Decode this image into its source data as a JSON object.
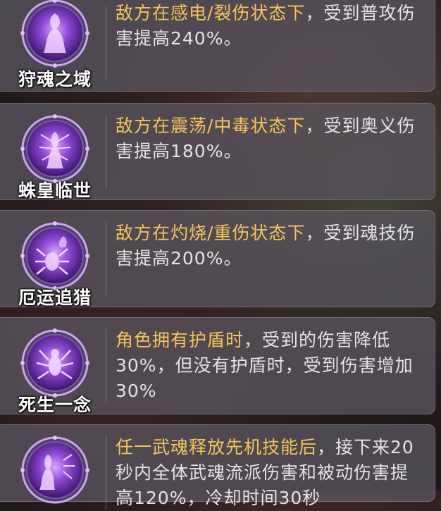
{
  "skills": [
    {
      "name": "狩魂之域",
      "icon": "ghost-woman-icon",
      "highlight": "敌方在感电/裂伤状态下",
      "rest": "，受到普攻伤害提高240%。"
    },
    {
      "name": "蛛皇临世",
      "icon": "spider-queen-icon",
      "highlight": "敌方在震荡/中毒状态下",
      "rest": "，受到奥义伤害提高180%。"
    },
    {
      "name": "厄运追猎",
      "icon": "spider-hunter-icon",
      "highlight": "敌方在灼烧/重伤状态下",
      "rest": "，受到魂技伤害提高200%。"
    },
    {
      "name": "死生一念",
      "icon": "spider-shield-icon",
      "highlight": "角色拥有护盾时",
      "rest": "，受到的伤害降低30%，但没有护盾时，受到伤害增加30%"
    },
    {
      "name": "",
      "icon": "spirit-pair-icon",
      "highlight": "任一武魂释放先机技能后",
      "rest": "，接下来20秒内全体武魂流派伤害和被动伤害提高120%，冷却时间30秒"
    }
  ],
  "colors": {
    "highlight": "#f6c55b",
    "text": "#e6e3e8",
    "emblem_ring": "#b78ef0",
    "emblem_core": "#6a2fb0"
  }
}
